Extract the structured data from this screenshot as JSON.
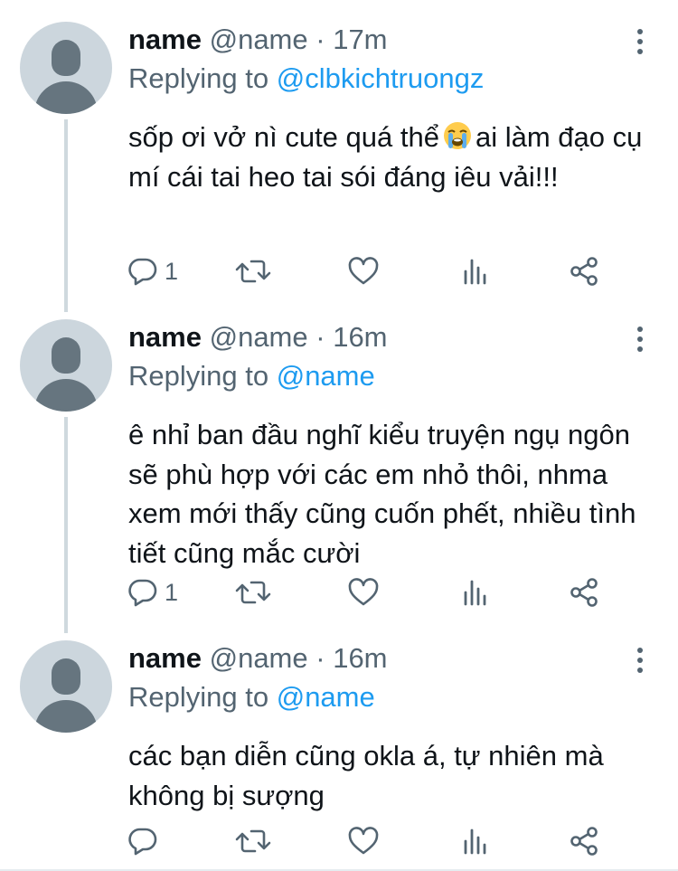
{
  "tweets": [
    {
      "display_name": "name",
      "handle": "@name",
      "separator": "·",
      "time": "17m",
      "replying_prefix": "Replying to",
      "replying_to": "@clbkichtruongz",
      "text_before_emoji": "sốp ơi vở nì cute quá thể",
      "emoji": "loudly-crying-face",
      "text_after_emoji": "ai làm đạo cụ mí cái tai heo tai sói đáng iêu vải!!!",
      "reply_count": "1",
      "retweet_count": "",
      "like_count": ""
    },
    {
      "display_name": "name",
      "handle": "@name",
      "separator": "·",
      "time": "16m",
      "replying_prefix": "Replying to",
      "replying_to": "@name",
      "text": "ê nhỉ ban đầu nghĩ kiểu truyện ngụ ngôn sẽ phù hợp với các em nhỏ thôi, nhma xem mới thấy cũng cuốn phết, nhiều tình tiết cũng mắc cười",
      "reply_count": "1",
      "retweet_count": "",
      "like_count": ""
    },
    {
      "display_name": "name",
      "handle": "@name",
      "separator": "·",
      "time": "16m",
      "replying_prefix": "Replying to",
      "replying_to": "@name",
      "text": "các bạn diễn cũng okla á, tự nhiên mà không bị sượng",
      "reply_count": "",
      "retweet_count": "",
      "like_count": ""
    }
  ],
  "icons": {
    "avatar": "default-avatar-icon",
    "more": "more-vertical-icon",
    "reply": "reply-icon",
    "retweet": "retweet-icon",
    "like": "heart-icon",
    "stats": "analytics-icon",
    "share": "share-icon"
  },
  "colors": {
    "text": "#0f1419",
    "secondary": "#536471",
    "link": "#1d9bf0",
    "avatar_bg": "#ccd6dd",
    "avatar_fg": "#66757f",
    "thread_line": "#cfd9de"
  }
}
